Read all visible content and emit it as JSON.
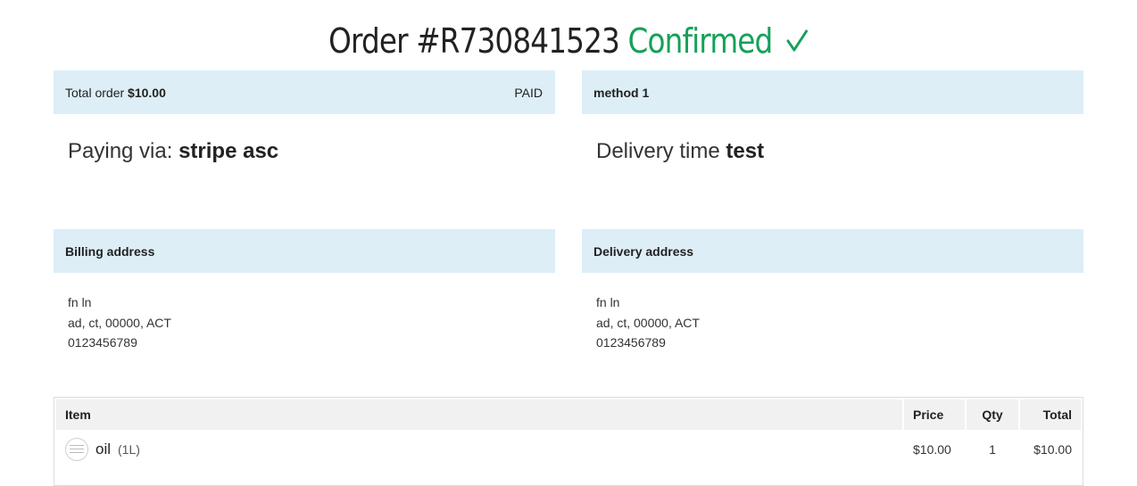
{
  "header": {
    "order_prefix": "Order",
    "order_number": "#R730841523",
    "status": "Confirmed",
    "status_icon": "check-icon"
  },
  "payment": {
    "total_label": "Total order",
    "total_amount": "$10.00",
    "payment_state": "PAID",
    "paying_via_label": "Paying via:",
    "paying_via_value": "stripe asc"
  },
  "shipping": {
    "method": "method 1",
    "delivery_time_label": "Delivery time",
    "delivery_time_value": "test"
  },
  "billing_address": {
    "heading": "Billing address",
    "name": "fn ln",
    "line": "ad, ct, 00000, ACT",
    "phone": "0123456789"
  },
  "delivery_address": {
    "heading": "Delivery address",
    "name": "fn ln",
    "line": "ad, ct, 00000, ACT",
    "phone": "0123456789"
  },
  "items_table": {
    "columns": {
      "item": "Item",
      "price": "Price",
      "qty": "Qty",
      "total": "Total"
    },
    "rows": [
      {
        "name": "oil",
        "size": "(1L)",
        "price": "$10.00",
        "qty": "1",
        "total": "$10.00"
      }
    ]
  }
}
